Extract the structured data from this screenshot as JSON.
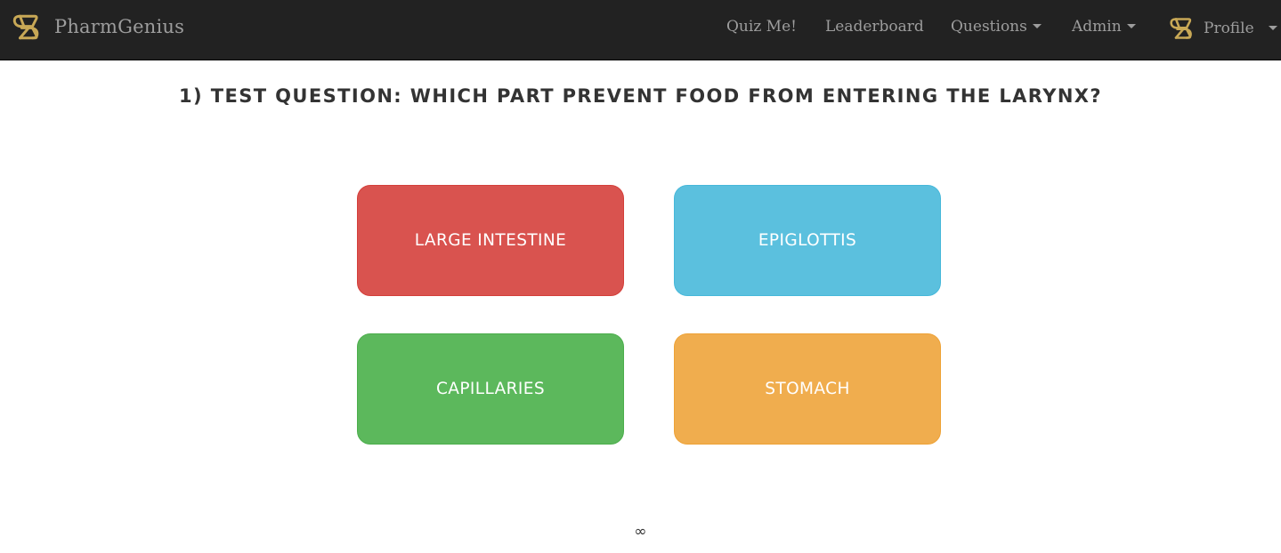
{
  "brand": {
    "name": "PharmGenius",
    "logo_icon": "pharmgenius-logo-icon",
    "logo_color": "#c8a856"
  },
  "nav": {
    "quiz": "Quiz Me!",
    "leaderboard": "Leaderboard",
    "questions": "Questions",
    "admin": "Admin",
    "profile": "Profile"
  },
  "question": {
    "text": "1) TEST QUESTION: WHICH PART PREVENT FOOD FROM ENTERING THE LARYNX?"
  },
  "answers": [
    {
      "label": "LARGE INTESTINE",
      "color": "#d9534f"
    },
    {
      "label": "EPIGLOTTIS",
      "color": "#5bc0de"
    },
    {
      "label": "CAPILLARIES",
      "color": "#5cb85c"
    },
    {
      "label": "STOMACH",
      "color": "#f0ad4e"
    }
  ],
  "timer": {
    "text": "∞"
  },
  "colors": {
    "navbar": "#222222",
    "nav_text": "#9d9d9d"
  }
}
